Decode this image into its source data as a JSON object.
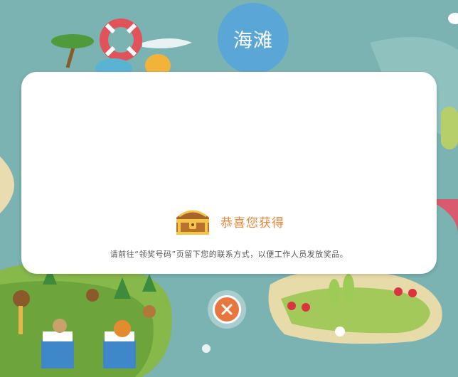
{
  "map": {
    "area_label": "海滩"
  },
  "modal": {
    "title": "恭喜您获得",
    "note": "请前往“领奖号码”页留下您的联系方式，以便工作人员发放奖品。"
  },
  "icons": {
    "chest": "treasure-chest-icon",
    "close": "close-icon"
  },
  "colors": {
    "accent": "#e8873c",
    "close_button": "#e8763f",
    "badge": "#5aa6d6",
    "background": "#7ab3b1"
  }
}
